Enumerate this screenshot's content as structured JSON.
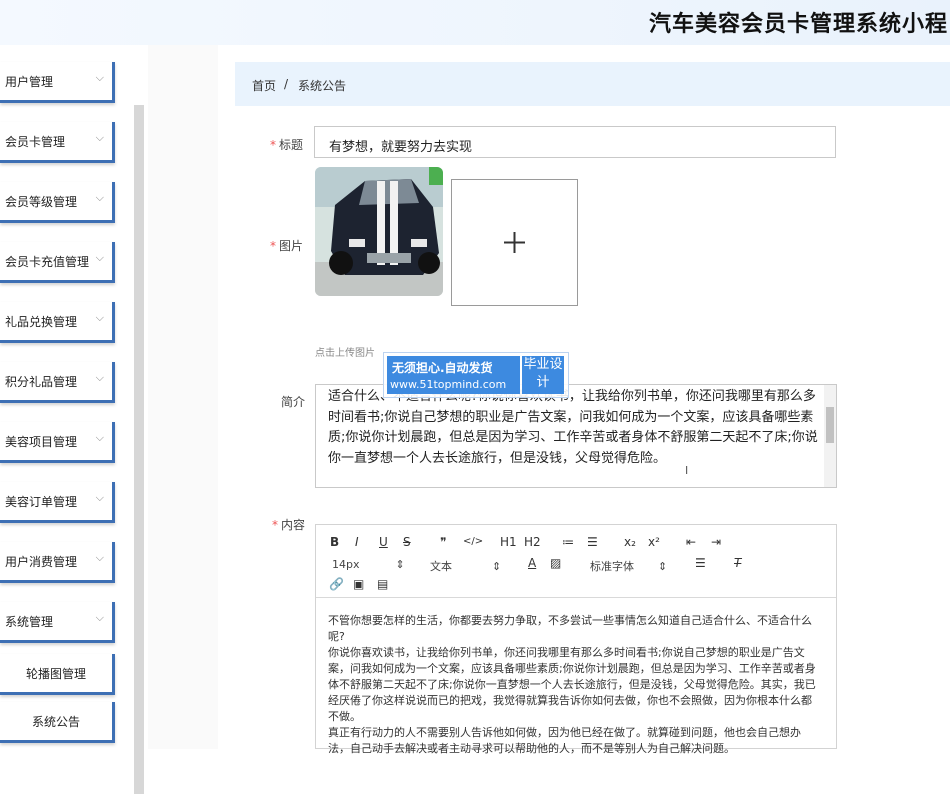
{
  "header": {
    "app_title": "汽车美容会员卡管理系统小程"
  },
  "sidebar": {
    "items": [
      {
        "label": "用户管理",
        "chevron": "⌵"
      },
      {
        "label": "会员卡管理",
        "chevron": "⌵"
      },
      {
        "label": "会员等级管理",
        "chevron": "⌵"
      },
      {
        "label": "会员卡充值管理",
        "chevron": "⌵"
      },
      {
        "label": "礼品兑换管理",
        "chevron": "⌵"
      },
      {
        "label": "积分礼品管理",
        "chevron": "⌵"
      },
      {
        "label": "美容项目管理",
        "chevron": "⌵"
      },
      {
        "label": "美容订单管理",
        "chevron": "⌵"
      },
      {
        "label": "用户消费管理",
        "chevron": "⌵"
      },
      {
        "label": "系统管理",
        "chevron": "⌵"
      },
      {
        "label": "轮播图管理"
      },
      {
        "label": "系统公告"
      }
    ]
  },
  "breadcrumb": {
    "home": "首页",
    "separator": "/",
    "current": "系统公告"
  },
  "form": {
    "title_label": "标题",
    "title_value": "有梦想，就要努力去实现",
    "image_label": "图片",
    "upload_hint": "点击上传图片",
    "intro_label": "简介",
    "intro_text": "适合什么、不适合什么呢?你说你喜欢读书，让我给你列书单，你还问我哪里有那么多时间看书;你说自己梦想的职业是广告文案，问我如何成为一个文案，应该具备哪些素质;你说你计划晨跑，但总是因为学习、工作辛苦或者身体不舒服第二天起不了床;你说你一直梦想一个人去长途旅行，但是没钱，父母觉得危险。",
    "content_label": "内容",
    "required_mark": "*"
  },
  "watermark": {
    "line1": "无须担心.自动发货",
    "line2": "www.51topmind.com",
    "badge": "毕业设计"
  },
  "editor": {
    "row1": [
      "B",
      "I",
      "U",
      "S",
      "❞",
      "</>",
      "H1",
      "H2",
      "≔",
      "☰",
      "x₂",
      "x²",
      "⇤",
      "⇥"
    ],
    "font_size": "14px",
    "paragraph": "文本",
    "font_family": "标准字体",
    "body": "不管你想要怎样的生活，你都要去努力争取，不多尝试一些事情怎么知道自己适合什么、不适合什么呢?\n你说你喜欢读书，让我给你列书单，你还问我哪里有那么多时间看书;你说自己梦想的职业是广告文案，问我如何成为一个文案，应该具备哪些素质;你说你计划晨跑，但总是因为学习、工作辛苦或者身体不舒服第二天起不了床;你说你一直梦想一个人去长途旅行，但是没钱，父母觉得危险。其实，我已经厌倦了你这样说说而已的把戏，我觉得就算我告诉你如何去做，你也不会照做，因为你根本什么都不做。\n真正有行动力的人不需要别人告诉他如何做，因为他已经在做了。就算碰到问题，他也会自己想办法，自己动手去解决或者主动寻求可以帮助他的人，而不是等别人为自己解决问题。"
  }
}
